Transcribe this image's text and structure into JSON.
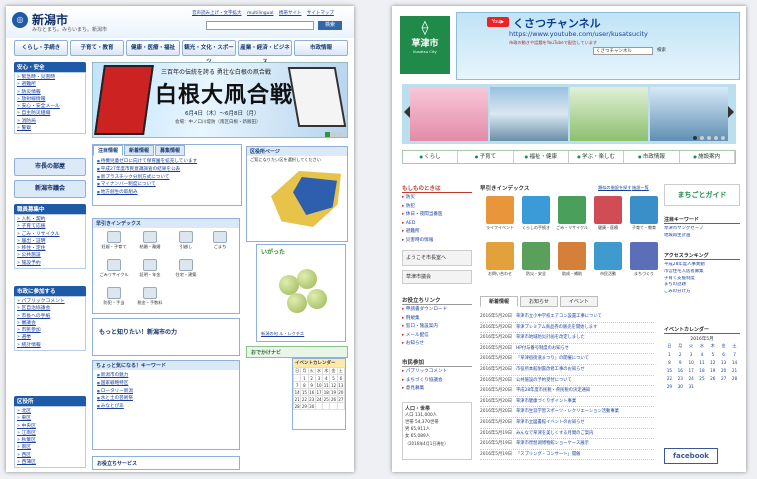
{
  "left": {
    "city_name": "新潟市",
    "tagline": "みなとまち。みらいまち。新潟市",
    "top_links": [
      "音声読み上げ・文字拡大",
      "multilingual",
      "携帯サイト",
      "サイトマップ"
    ],
    "search_button": "検索",
    "nav": [
      "くらし・手続き",
      "子育て・教育",
      "健康・医療・福祉",
      "観光・文化・スポーツ",
      "産業・経済・ビジネス",
      "市政情報"
    ],
    "safety": {
      "heading": "安心・安全",
      "items": [
        "緊急時・災害時",
        "避難所",
        "防災情報",
        "放射線情報",
        "安心・安全メール",
        "自主防災組織",
        "消防局",
        "警察"
      ]
    },
    "mayor_button": "市長の部屋",
    "assembly_button": "新潟市議会",
    "recruit": {
      "heading": "職員募集中",
      "items": [
        "入札・契約",
        "子育て応援",
        "ごみ・リサイクル",
        "届出・証明",
        "移住・定住",
        "公共施設",
        "施設予約"
      ]
    },
    "participation": {
      "heading": "市政に参加する",
      "items": [
        "パブリックコメント",
        "区自治協議会",
        "市長への手紙",
        "審議会",
        "市民参加",
        "選挙",
        "統計情報"
      ]
    },
    "ward": {
      "heading": "区役所",
      "items": [
        "北区",
        "東区",
        "中央区",
        "江南区",
        "秋葉区",
        "南区",
        "西区",
        "西蒲区"
      ]
    },
    "banner": {
      "title": "三百年の伝統を誇る 勇壮な白根の凧合戦",
      "big_text": "白根大凧合戦",
      "date": "6月4日（木）〜6月8日（月）",
      "place": "会場：中ノ口川堤防（南区白根・新飯田）"
    },
    "news_tabs": [
      "注目情報",
      "新着情報",
      "募集情報"
    ],
    "news_items": [
      "待機児童ゼロに向けて保育園を拡充しています",
      "平成27年度市民意識調査の結果を公表",
      "新プラスチック分別方式について",
      "マイナンバー制度について",
      "地方創生の取組み"
    ],
    "map_title": "区役所ページ",
    "map_note": "ご覧になりたい区を選択してください",
    "index_title": "早引きインデックス",
    "index_items": [
      "妊娠・子育て",
      "結婚・離婚",
      "引越し",
      "ごまち",
      "ごみリサイクル",
      "証明・年金",
      "住宅・建築",
      "防犯・手当",
      "税金・手数料"
    ],
    "fruit_title": "いがった",
    "fruit_caption": "新潟の旬 ル・レクチエ",
    "learn_more": "もっと知りたい！新潟市の力",
    "ask_title": "ちょっと気になる！キーワード",
    "ask_items": [
      "新潟市の魅力",
      "国家戦略特区",
      "ロータリー新潟",
      "水と土の芸術祭",
      "みなとぴあ"
    ],
    "calendar_title": "イベントカレンダー",
    "calendar_days": [
      "日",
      "月",
      "火",
      "水",
      "木",
      "金",
      "土"
    ],
    "calendar_rows": [
      [
        "",
        "1",
        "2",
        "3",
        "4",
        "5",
        "6"
      ],
      [
        "7",
        "8",
        "9",
        "10",
        "11",
        "12",
        "13"
      ],
      [
        "14",
        "15",
        "16",
        "17",
        "18",
        "19",
        "20"
      ],
      [
        "21",
        "22",
        "23",
        "24",
        "25",
        "26",
        "27"
      ],
      [
        "28",
        "29",
        "30",
        "",
        "",
        "",
        ""
      ]
    ],
    "nav_bottom": "お役立ちサービス",
    "osusume": "おでかけナビ"
  },
  "right": {
    "city_name": "草津市",
    "city_en": "Kusatsu City",
    "channel_title": "くさつチャンネル",
    "channel_url": "https://www.youtube.com/user/kusatsucity",
    "channel_note": "市政の動きや話題をYouTubeで配信しています",
    "channel_search": "くさつチャンネル",
    "channel_search_btn": "検索",
    "nav": [
      "くらし",
      "子育て",
      "福祉・健康",
      "学ぶ・楽しむ",
      "市政情報",
      "施設案内"
    ],
    "emergency": {
      "heading": "もしものときは",
      "items": [
        "防災",
        "防犯",
        "休日・夜間当番医",
        "AED",
        "避難所",
        "災害時の情報"
      ]
    },
    "mayor_label": "ようこそ市長室へ",
    "council_label": "草津市議会",
    "index_title": "早引きインデックス",
    "index_links": [
      "類似の施設を探す",
      "施設一覧"
    ],
    "icons": [
      "ライフイベント",
      "くらしの手続き",
      "ごみ・リサイクル",
      "健康・医療",
      "子育て・教育",
      "お問い合わせ",
      "防災・安全",
      "助成・補助",
      "市民活動",
      "まちづくり"
    ],
    "links_title": "お役立ちリンク",
    "links": [
      "申請書ダウンロード",
      "例規集",
      "窓口・施設案内",
      "メール配信",
      "お知らせ"
    ],
    "citizens_title": "市民参加",
    "citizens": [
      "パブリックコメント",
      "まちづくり協議会",
      "意見募集"
    ],
    "population_title": "人口・世帯",
    "population": [
      "人口 131,000人",
      "世帯 54,370世帯",
      "男 65,911人",
      "女 65,089人",
      "（2016年4月1日現在）"
    ],
    "news_tabs": [
      "新着情報",
      "お知らせ",
      "イベント"
    ],
    "news": [
      [
        "2016年5月20日",
        "草津市立小中学校エアコン設置工事について"
      ],
      [
        "2016年5月20日",
        "草津プレミアム商品券の販売を開始します"
      ],
      [
        "2016年5月20日",
        "草津市地域防災計画を改定しました"
      ],
      [
        "2016年5月20日",
        "HP付与番号制度のお知らせ"
      ],
      [
        "2016年5月20日",
        "「草津宿街道まつり」の開催について"
      ],
      [
        "2016年5月20日",
        "市役所本館耐震改修工事のお知らせ"
      ],
      [
        "2016年5月20日",
        "公共施設の予約受付について"
      ],
      [
        "2016年5月20日",
        "平成28年度市民税・県民税の決定通知"
      ],
      [
        "2016年5月20日",
        "草津市健康づくりポイント事業"
      ],
      [
        "2016年5月20日",
        "草津市生涯学習スポーツ・レクリエーション活動事業"
      ],
      [
        "2016年5月20日",
        "草津市立図書館イベントのお知らせ"
      ],
      [
        "2016年5月19日",
        "みんなで草津を美しくする月間のご案内"
      ],
      [
        "2016年5月19日",
        "草津市琵琶湖博物館ショーケース展示"
      ],
      [
        "2016年5月19日",
        "「スプリング・コンサート」開催"
      ]
    ],
    "side_title": "まちごとガイド",
    "keyword_title": "注目キーワード",
    "keywords": [
      "草津市ヤングセーフ",
      "地域再生計画"
    ],
    "access_title": "アクセスランキング",
    "access": [
      "平成28年度人事異動",
      "市営住宅入居者募集",
      "子育て支援制度",
      "まちの話題",
      "ごみの分け方"
    ],
    "event_title": "イベントカレンダー",
    "event_month": "2016年5月",
    "cal_days": [
      "日",
      "月",
      "火",
      "水",
      "木",
      "金",
      "土"
    ],
    "cal_rows": [
      [
        "1",
        "2",
        "3",
        "4",
        "5",
        "6",
        "7"
      ],
      [
        "8",
        "9",
        "10",
        "11",
        "12",
        "13",
        "14"
      ],
      [
        "15",
        "16",
        "17",
        "18",
        "19",
        "20",
        "21"
      ],
      [
        "22",
        "23",
        "24",
        "25",
        "26",
        "27",
        "28"
      ],
      [
        "29",
        "30",
        "31",
        "",
        "",
        "",
        ""
      ]
    ],
    "facebook": "facebook"
  }
}
